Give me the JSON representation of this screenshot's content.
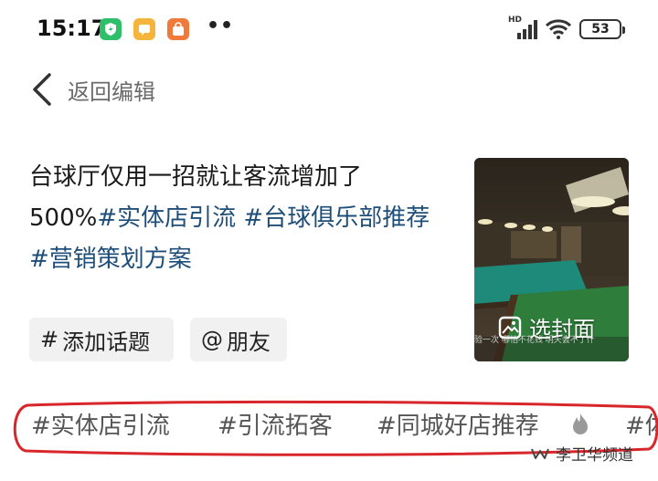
{
  "status_bar": {
    "time": "15:17",
    "network_label": "HD",
    "battery": "53",
    "app_icons": [
      "shield-icon",
      "chat-icon",
      "shopping-bag-icon"
    ],
    "more": "••"
  },
  "header": {
    "back_label": "返回编辑"
  },
  "caption": {
    "text": "台球厅仅用一招就让客流增加了500%",
    "hashtags": [
      "#实体店引流",
      "#台球俱乐部推荐",
      "#营销策划方案"
    ]
  },
  "cover": {
    "button_label": "选封面",
    "subtitle": "验一次 哪怕不花钱 明天会不了什"
  },
  "chips": {
    "add_topic": "添加话题",
    "add_topic_symbol": "#",
    "mention_friend": "朋友",
    "mention_symbol": "@"
  },
  "suggestions": [
    "#实体店引流",
    "#引流拓客",
    "#同城好店推荐",
    "#体"
  ],
  "watermark": {
    "text": "李卫华频道"
  },
  "colors": {
    "hashtag": "#1f4e79",
    "highlight_ellipse": "#d8262b",
    "chip_bg": "#f1f1f1"
  }
}
